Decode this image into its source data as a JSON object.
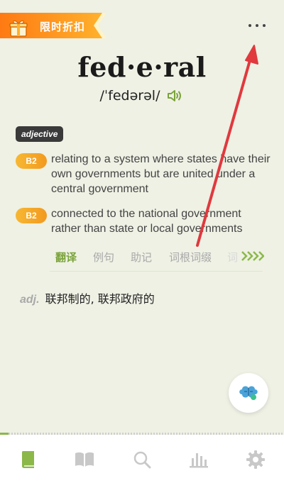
{
  "promo": {
    "label": "限时折扣"
  },
  "word": {
    "headword": "fed·e·ral",
    "pronunciation": "/ˈfedərəl/"
  },
  "part_of_speech": "adjective",
  "senses": [
    {
      "level": "B2",
      "definition": "relating to a system where states have their own governments but are united under a central government"
    },
    {
      "level": "B2",
      "definition": "connected to the national government rather than state or local governments"
    }
  ],
  "tabs": [
    "翻译",
    "例句",
    "助记",
    "词根词缀",
    "词"
  ],
  "translation": {
    "pos": "adj.",
    "text": "联邦制的, 联邦政府的"
  },
  "bottom_nav": [
    "book-icon",
    "open-book-icon",
    "search-icon",
    "stats-icon",
    "gear-icon"
  ],
  "progress": {
    "fraction": 0.03
  },
  "colors": {
    "accent": "#7aa33a",
    "level": "#f29a1f",
    "annotation": "#e0393e"
  }
}
